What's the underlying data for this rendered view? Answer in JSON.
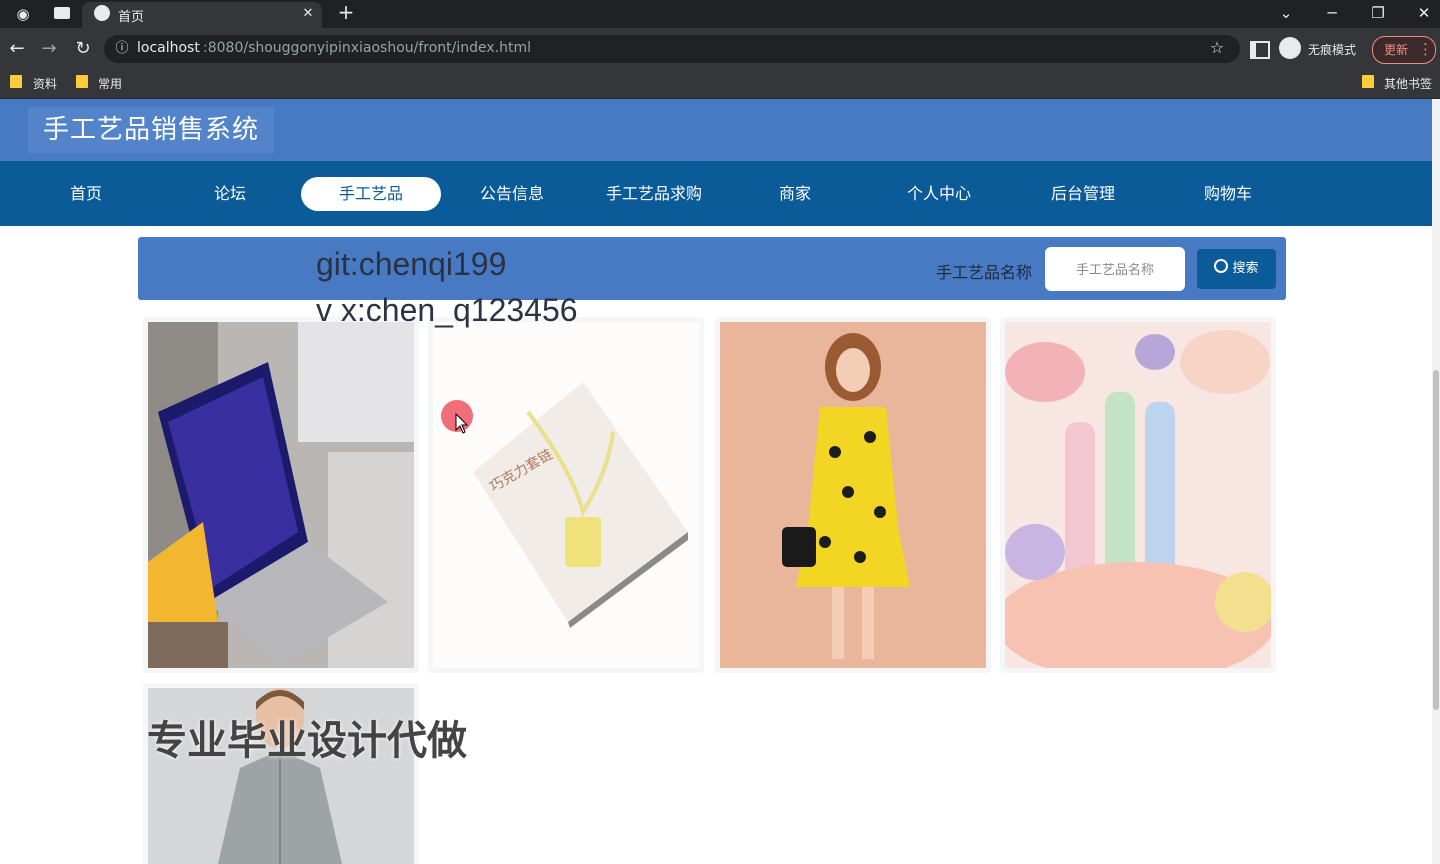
{
  "browser": {
    "tab_title": "首页",
    "new_tab_symbol": "+",
    "close_symbol": "✕",
    "url_host": "localhost",
    "url_path": ":8080/shouggonyipinxiaoshou/front/index.html",
    "profile_label": "无痕模式",
    "update_label": "更新",
    "bookmarks": [
      "资料",
      "常用"
    ],
    "other_bookmarks": "其他书签"
  },
  "site": {
    "title": "手工艺品销售系统",
    "nav": [
      "首页",
      "论坛",
      "手工艺品",
      "公告信息",
      "手工艺品求购",
      "商家",
      "个人中心",
      "后台管理",
      "购物车"
    ],
    "active_nav": "手工艺品"
  },
  "search": {
    "label": "手工艺品名称",
    "placeholder": "手工艺品名称",
    "button_label": "搜索"
  },
  "watermarks": [
    "git:chenqi199",
    "v x:chen_q123456",
    "专业毕业设计代做"
  ],
  "products": [
    {
      "image": "laptop-photo"
    },
    {
      "image": "chocolate-necklace-photo"
    },
    {
      "image": "yellow-dress-photo"
    },
    {
      "image": "pastel-knit-photo"
    },
    {
      "image": "gray-shirt-photo"
    }
  ],
  "colors": {
    "header_blue": "#4879c3",
    "nav_blue": "#0b5b98",
    "chrome_dark": "#202124"
  }
}
